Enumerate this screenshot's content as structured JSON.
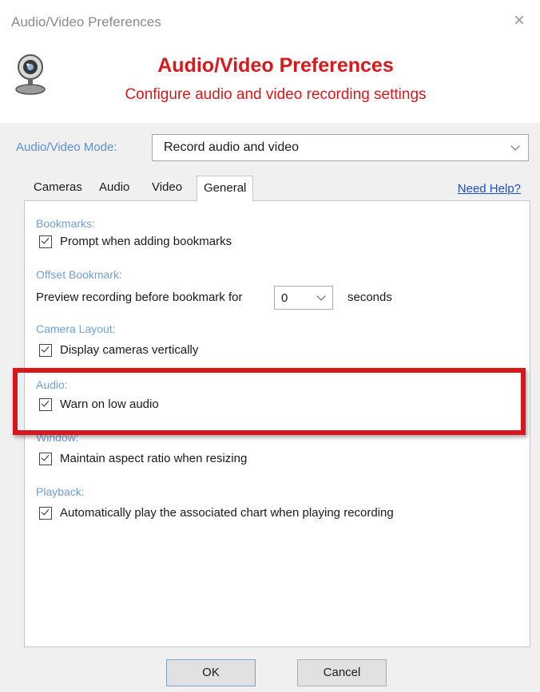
{
  "window": {
    "title": "Audio/Video Preferences",
    "close_glyph": "×"
  },
  "header": {
    "icon": "webcam-icon",
    "title": "Audio/Video Preferences",
    "subtitle": "Configure audio and video recording settings",
    "accent_color": "#d8191b"
  },
  "mode": {
    "label": "Audio/Video Mode:",
    "selected": "Record audio and video"
  },
  "tabs": [
    {
      "label": "Cameras",
      "active": false
    },
    {
      "label": "Audio",
      "active": false
    },
    {
      "label": "Video",
      "active": false
    },
    {
      "label": "General",
      "active": true
    }
  ],
  "help_link": "Need Help?",
  "sections": {
    "bookmarks": {
      "label": "Bookmarks:",
      "option": "Prompt when adding bookmarks",
      "checked": true
    },
    "offset_bookmark": {
      "label": "Offset Bookmark:",
      "prefix": "Preview recording before bookmark for",
      "value": "0",
      "suffix": "seconds"
    },
    "camera_layout": {
      "label": "Camera Layout:",
      "option": "Display cameras vertically",
      "checked": true
    },
    "audio": {
      "label": "Audio:",
      "option": "Warn on low audio",
      "checked": true,
      "highlighted": true,
      "highlight_color": "#d9161c"
    },
    "window": {
      "label": "Window:",
      "option": "Maintain aspect ratio when resizing",
      "checked": true
    },
    "playback": {
      "label": "Playback:",
      "option": "Automatically play the associated chart when playing recording",
      "checked": true
    }
  },
  "buttons": {
    "ok": "OK",
    "cancel": "Cancel"
  },
  "link_color": "#1a4fd8",
  "section_label_color": "#6f9ed6"
}
